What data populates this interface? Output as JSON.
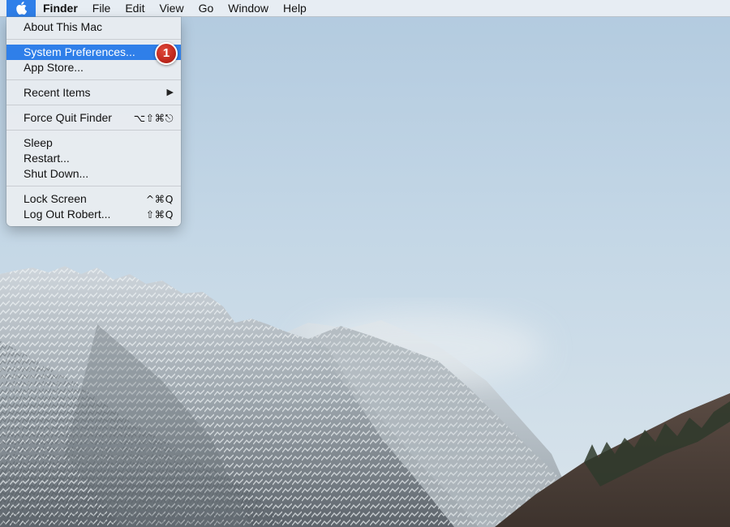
{
  "menubar": {
    "apple_icon": "apple-logo-icon",
    "items": [
      "Finder",
      "File",
      "Edit",
      "View",
      "Go",
      "Window",
      "Help"
    ]
  },
  "apple_menu": {
    "about": "About This Mac",
    "system_preferences": "System Preferences...",
    "app_store": "App Store...",
    "recent_items": "Recent Items",
    "force_quit": "Force Quit Finder",
    "force_quit_shortcut": "⌥⇧⌘⎋",
    "sleep": "Sleep",
    "restart": "Restart...",
    "shut_down": "Shut Down...",
    "lock_screen": "Lock Screen",
    "lock_screen_shortcut": "^⌘Q",
    "log_out": "Log Out Robert...",
    "log_out_shortcut": "⇧⌘Q",
    "step_badge": "1"
  },
  "colors": {
    "accent": "#2f7fe9",
    "badge": "#c32a1f"
  }
}
